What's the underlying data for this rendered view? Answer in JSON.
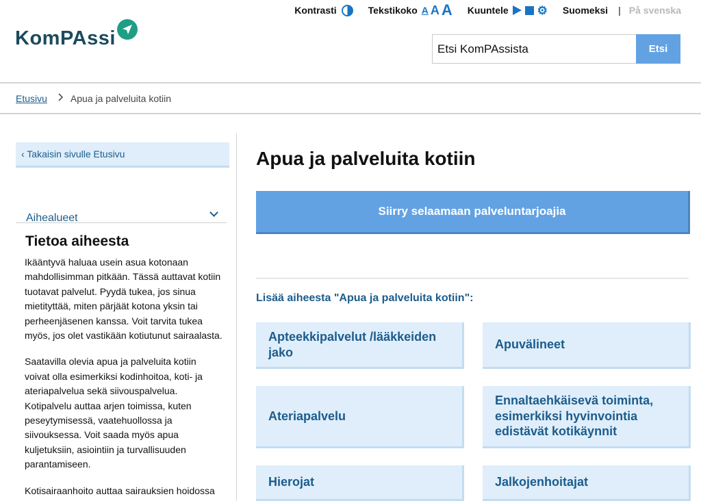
{
  "header": {
    "logo_text": "KomPAssi",
    "toolbar": {
      "contrast_label": "Kontrasti",
      "text_size_label": "Tekstikoko",
      "text_size_options": [
        "A",
        "A",
        "A"
      ],
      "listen_label": "Kuuntele",
      "lang_fi": "Suomeksi",
      "lang_separator": "|",
      "lang_sv": "På svenska"
    },
    "search": {
      "value": "Etsi KomPAssista",
      "button_label": "Etsi"
    }
  },
  "breadcrumb": {
    "home": "Etusivu",
    "current": "Apua ja palveluita kotiin"
  },
  "sidebar": {
    "back_link": "‹ Takaisin sivulle Etusivu",
    "topics_label": "Aihealueet",
    "heading": "Tietoa aiheesta",
    "paragraphs": [
      "Ikääntyvä haluaa usein asua kotonaan mahdollisimman pitkään. Tässä auttavat kotiin tuotavat palvelut. Pyydä tukea, jos sinua mietityttää, miten pärjäät kotona yksin tai perheenjäsenen kanssa. Voit tarvita tukea myös, jos olet vastikään kotiutunut sairaalasta.",
      "Saatavilla olevia apua ja palveluita kotiin voivat olla esimerkiksi kodinhoitoa, koti- ja ateriapalvelua sekä siivouspalvelua. Kotipalvelu auttaa arjen toimissa, kuten peseytymisessä, vaatehuollossa ja siivouksessa. Voit saada myös apua kuljetuksiin, asiointiin ja turvallisuuden parantamiseen.",
      "Kotisairaanhoito auttaa sairauksien hoidossa ja kuntoutuksessa. Voit saada kotiin"
    ]
  },
  "main": {
    "title": "Apua ja palveluita kotiin",
    "cta_label": "Siirry selaamaan palveluntarjoajia",
    "more_heading": "Lisää aiheesta \"Apua ja palveluita kotiin\":",
    "topics": [
      "Apteekkipalvelut /lääkkeiden jako",
      "Apuvälineet",
      "Ateriapalvelu",
      "Ennaltaehkäisevä toiminta, esimerkiksi hyvinvointia edistävät kotikäynnit",
      "Hierojat",
      "Jalkojenhoitajat"
    ]
  },
  "colors": {
    "accent_blue": "#62a2e3",
    "link_blue": "#1c5c8c",
    "card_bg": "#dfeefa",
    "logo_green": "#1f9e86",
    "logo_navy": "#1c4a5c"
  },
  "icons": [
    "compass-logo-icon",
    "contrast-icon",
    "play-icon",
    "stop-icon",
    "gear-icon",
    "chevron-right-icon",
    "chevron-down-icon"
  ]
}
